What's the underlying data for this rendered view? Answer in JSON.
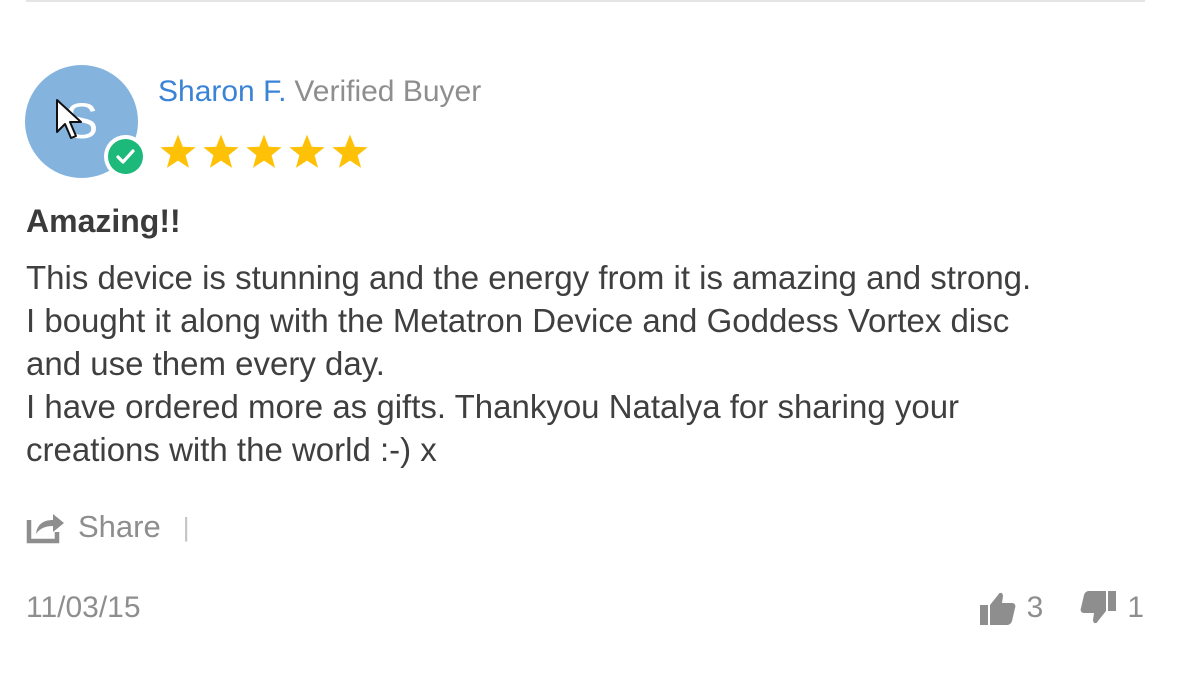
{
  "review": {
    "author": {
      "initial": "S",
      "name": "Sharon F.",
      "badge": "Verified Buyer"
    },
    "rating": {
      "value": 5,
      "max": 5
    },
    "title": "Amazing!!",
    "body_lines": [
      "This device is stunning and the energy from it is amazing and strong.",
      "I bought it along with the Metatron Device and Goddess Vortex disc",
      "and use them every day.",
      "I have ordered more as gifts. Thankyou Natalya for sharing your",
      "creations with the world :-) x"
    ],
    "share_label": "Share",
    "separator": "|",
    "date": "11/03/15",
    "votes": {
      "up": "3",
      "down": "1"
    }
  },
  "icons": {
    "verified": "check-circle-icon",
    "star": "star-icon",
    "share": "share-icon",
    "thumbs_up": "thumbs-up-icon",
    "thumbs_down": "thumbs-down-icon",
    "cursor": "mouse-pointer-icon"
  },
  "colors": {
    "author_name": "#3a83d6",
    "avatar_bg": "#84b4de",
    "verified_badge": "#1cb97b",
    "star": "#ffc107",
    "muted_text": "#8e8e8e",
    "body_text": "#3f3f3f"
  }
}
